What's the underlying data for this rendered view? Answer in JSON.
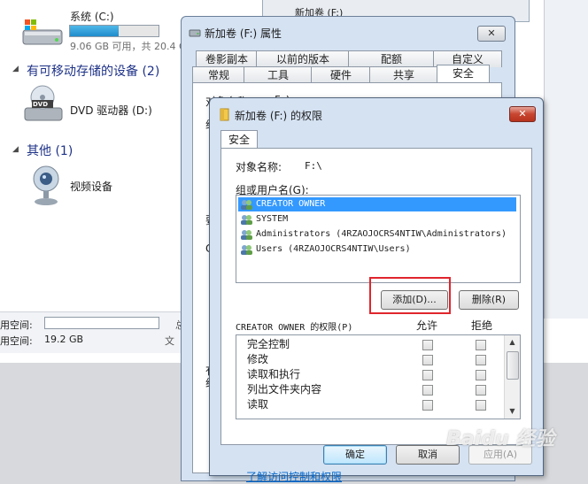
{
  "explorer": {
    "drive_c": {
      "name": "系统 (C:)",
      "size_text": "9.06 GB 可用，共 20.4 GB",
      "used_fraction": 0.55
    },
    "removable_header": "有可移动存储的设备 (2)",
    "dvd": {
      "name": "DVD 驱动器 (D:)",
      "icon_text": "DVD"
    },
    "other_header": "其他 (1)",
    "video": {
      "name": "视频设备"
    },
    "status": {
      "used_label": "用空间:",
      "free_label": "用空间:",
      "free_value": "19.2 GB",
      "col2_a": "总",
      "col2_b": "文"
    }
  },
  "properties_dialog": {
    "title": "新加卷 (F:) 属性",
    "behind_window_label": "新加卷 (F:)",
    "tabs_row1": [
      "卷影副本",
      "以前的版本",
      "配额",
      "自定义"
    ],
    "tabs_row2": [
      "常规",
      "工具",
      "硬件",
      "共享",
      "安全"
    ],
    "active_tab": "安全",
    "peek_labels": [
      "对象名称:",
      "F:\\",
      "组",
      "要",
      "C",
      "有",
      "组"
    ]
  },
  "permissions_dialog": {
    "title": "新加卷 (F:) 的权限",
    "close_glyph": "✕",
    "tab": "安全",
    "object_name_label": "对象名称:",
    "object_name_value": "F:\\",
    "group_label": "组或用户名(G):",
    "users": [
      "CREATOR OWNER",
      "SYSTEM",
      "Administrators (4RZAOJOCRS4NTIW\\Administrators)",
      "Users (4RZAOJOCRS4NTIW\\Users)"
    ],
    "selected_user_index": 0,
    "add_button": "添加(D)...",
    "remove_button": "删除(R)",
    "permissions_for_label": "CREATOR OWNER 的权限(P)",
    "allow_label": "允许",
    "deny_label": "拒绝",
    "permissions": [
      "完全控制",
      "修改",
      "读取和执行",
      "列出文件夹内容",
      "读取"
    ],
    "link_text": "了解访问控制和权限",
    "ok_button": "确定",
    "cancel_button": "取消",
    "apply_button": "应用(A)"
  },
  "watermark": "Baidu 经验",
  "colors": {
    "highlight": "#e0252d",
    "selection": "#3399ff",
    "link": "#0066cc",
    "section_header": "#1e3287"
  }
}
